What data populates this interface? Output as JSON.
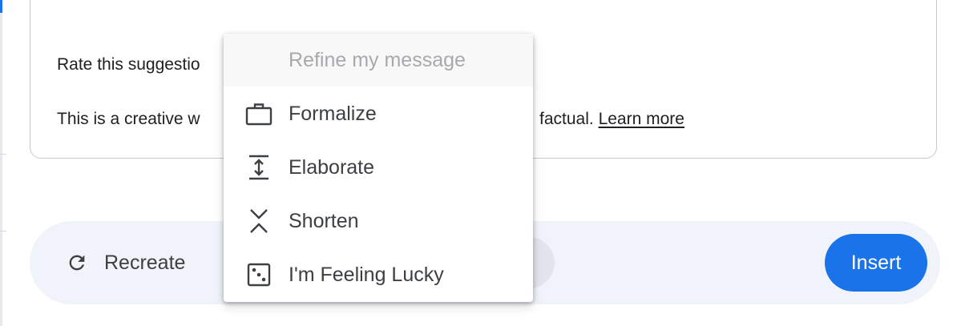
{
  "card": {
    "rate_text": "Rate this suggestio",
    "disclaimer_head": "This is a creative w",
    "disclaimer_tail": "factual.",
    "learn_more": "Learn more"
  },
  "menu": {
    "header": "Refine my message",
    "items": [
      {
        "label": "Formalize",
        "icon": "briefcase-icon"
      },
      {
        "label": "Elaborate",
        "icon": "expand-vertical-icon"
      },
      {
        "label": "Shorten",
        "icon": "collapse-vertical-icon"
      },
      {
        "label": "I'm Feeling Lucky",
        "icon": "dice-icon"
      }
    ]
  },
  "actions": {
    "recreate_label": "Recreate",
    "insert_label": "Insert"
  },
  "colors": {
    "accent": "#1a73e8",
    "actionbar_bg": "#f1f3fb",
    "text": "#202124",
    "muted": "#a7a9ad"
  }
}
